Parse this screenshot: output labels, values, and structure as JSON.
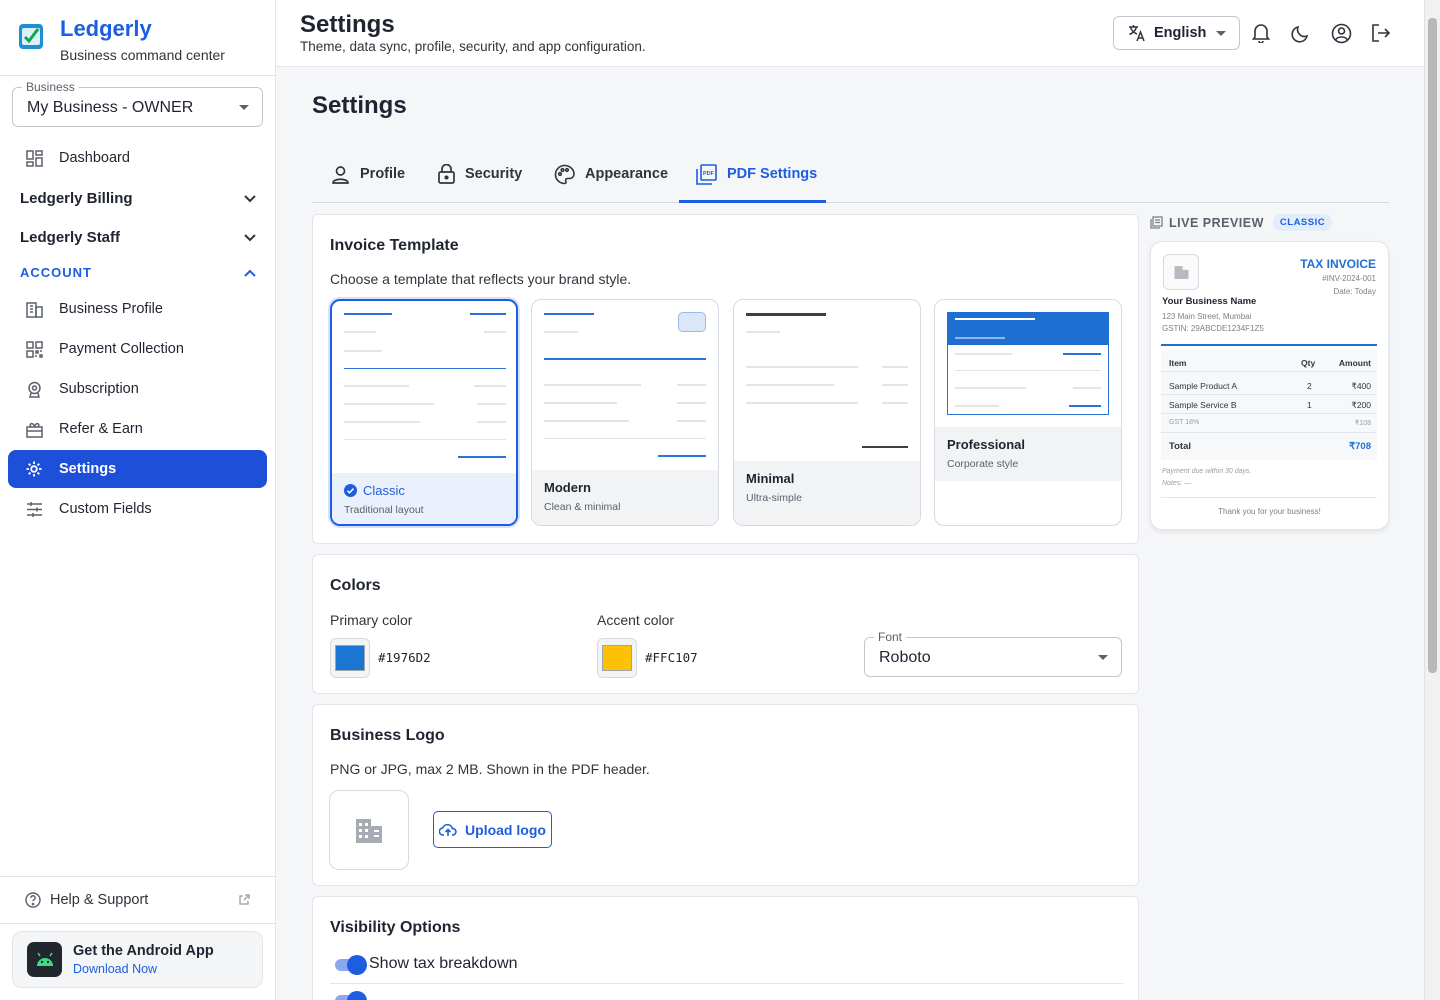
{
  "brand": {
    "name": "Ledgerly",
    "tagline": "Business command center"
  },
  "business_select": {
    "label": "Business",
    "value": "My Business - OWNER"
  },
  "nav": {
    "dashboard": "Dashboard",
    "billing": "Ledgerly Billing",
    "staff": "Ledgerly Staff",
    "account_section": "ACCOUNT",
    "items": {
      "business_profile": "Business Profile",
      "payment_collection": "Payment Collection",
      "subscription": "Subscription",
      "refer_earn": "Refer & Earn",
      "settings": "Settings",
      "custom_fields": "Custom Fields"
    },
    "help": "Help & Support"
  },
  "android_promo": {
    "title": "Get the Android App",
    "link": "Download Now"
  },
  "topbar": {
    "title": "Settings",
    "subtitle": "Theme, data sync, profile, security, and app configuration.",
    "language": "English"
  },
  "page": {
    "heading": "Settings",
    "tabs": {
      "profile": "Profile",
      "security": "Security",
      "appearance": "Appearance",
      "pdf": "PDF Settings"
    }
  },
  "invoice_template": {
    "title": "Invoice Template",
    "description": "Choose a template that reflects your brand style.",
    "options": [
      {
        "name": "Classic",
        "desc": "Traditional layout"
      },
      {
        "name": "Modern",
        "desc": "Clean & minimal"
      },
      {
        "name": "Minimal",
        "desc": "Ultra-simple"
      },
      {
        "name": "Professional",
        "desc": "Corporate style"
      }
    ]
  },
  "colors": {
    "title": "Colors",
    "primary_label": "Primary color",
    "primary_value": "#1976D2",
    "accent_label": "Accent color",
    "accent_value": "#FFC107",
    "font_label": "Font",
    "font_value": "Roboto"
  },
  "business_logo": {
    "title": "Business Logo",
    "description": "PNG or JPG, max 2 MB. Shown in the PDF header.",
    "upload_label": "Upload logo"
  },
  "visibility": {
    "title": "Visibility Options",
    "show_tax": "Show tax breakdown",
    "show_tax_on": true
  },
  "preview": {
    "header": "LIVE PREVIEW",
    "badge": "CLASSIC",
    "doc_title": "TAX INVOICE",
    "invoice_no": "#INV-2024-001",
    "date": "Date: Today",
    "business_name": "Your Business Name",
    "address": "123 Main Street, Mumbai",
    "gstin": "GSTIN: 29ABCDE1234F1Z5",
    "col_item": "Item",
    "col_qty": "Qty",
    "col_amount": "Amount",
    "rows": [
      {
        "item": "Sample Product A",
        "qty": "2",
        "amount": "₹400"
      },
      {
        "item": "Sample Service B",
        "qty": "1",
        "amount": "₹200"
      }
    ],
    "tax_label": "GST 18%",
    "tax_amount": "₹108",
    "total_label": "Total",
    "total_amount": "₹708",
    "payment_note": "Payment due within 30 days.",
    "notes": "Notes: —",
    "thanks": "Thank you for your business!"
  },
  "theme": {
    "accent": "#1d5ee0",
    "primary_swatch": "#1976D2",
    "accent_swatch": "#FFC107",
    "active_nav": "#1d4fd8"
  }
}
